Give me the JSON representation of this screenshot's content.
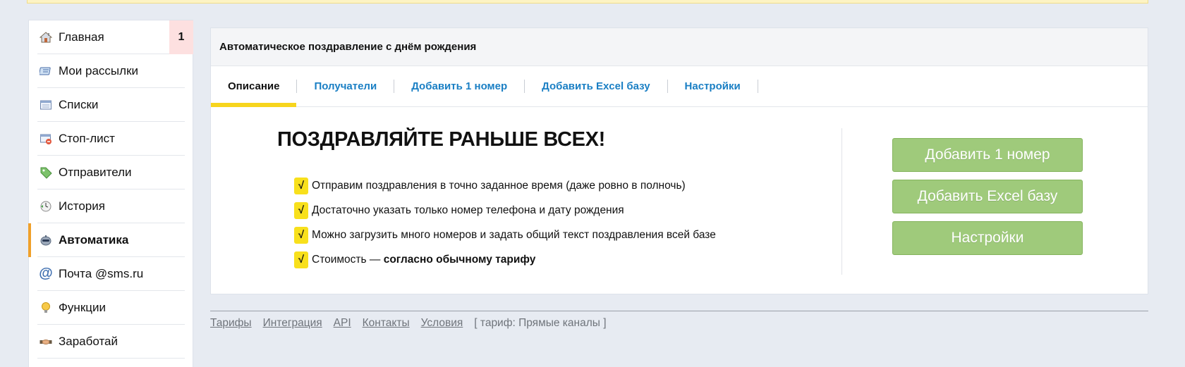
{
  "sidebar": {
    "items": [
      {
        "label": "Главная",
        "icon": "home-icon",
        "badge": "1"
      },
      {
        "label": "Мои рассылки",
        "icon": "mailings-icon"
      },
      {
        "label": "Списки",
        "icon": "lists-icon"
      },
      {
        "label": "Стоп-лист",
        "icon": "stoplist-icon"
      },
      {
        "label": "Отправители",
        "icon": "tag-icon"
      },
      {
        "label": "История",
        "icon": "history-clock-icon"
      },
      {
        "label": "Автоматика",
        "icon": "robot-icon",
        "active": true
      },
      {
        "label": "Почта @sms.ru",
        "icon": "at-icon"
      },
      {
        "label": "Функции",
        "icon": "lightbulb-icon"
      },
      {
        "label": "Заработай",
        "icon": "handshake-icon"
      }
    ]
  },
  "panel": {
    "title": "Автоматическое поздравление с днём рождения",
    "tabs": [
      {
        "label": "Описание",
        "active": true
      },
      {
        "label": "Получатели"
      },
      {
        "label": "Добавить 1 номер"
      },
      {
        "label": "Добавить Excel базу"
      },
      {
        "label": "Настройки"
      }
    ],
    "promo_title": "ПОЗДРАВЛЯЙТЕ РАНЬШЕ ВСЕХ!",
    "check_mark": "√",
    "benefits": [
      "Отправим поздравления в точно заданное время (даже ровно в полночь)",
      "Достаточно указать только номер телефона и дату рождения",
      "Можно загрузить много номеров и задать общий текст поздравления всей базе"
    ],
    "cost_prefix": "Стоимость — ",
    "cost_bold": "согласно обычному тарифу",
    "buttons": {
      "add_one": "Добавить 1 номер",
      "add_excel": "Добавить Excel базу",
      "settings": "Настройки"
    }
  },
  "footer": {
    "links": [
      "Тарифы",
      "Интеграция",
      "API",
      "Контакты",
      "Условия"
    ],
    "tariff_info": "[ тариф: Прямые каналы ]"
  },
  "colors": {
    "page_bg": "#e7ebf2",
    "link": "#1a7fc4",
    "active_tab_underline": "#f7d51d",
    "active_nav_marker": "#f0a02a",
    "cta_button": "#9fca7b",
    "badge_bg": "#fde0e0"
  }
}
